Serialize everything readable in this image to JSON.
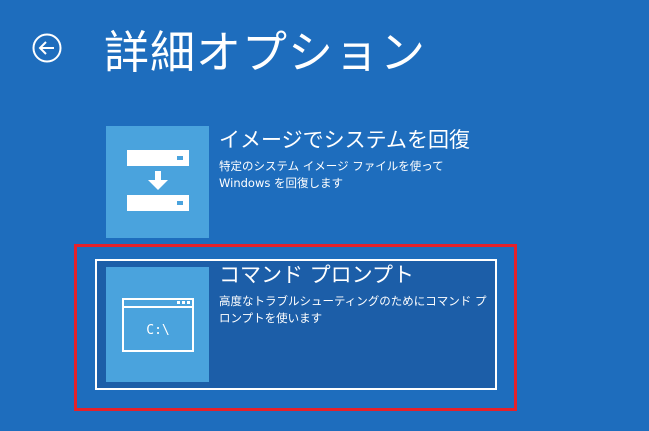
{
  "header": {
    "title": "詳細オプション",
    "back_icon": "back-arrow-icon"
  },
  "options": [
    {
      "title": "イメージでシステムを回復",
      "description": "特定のシステム イメージ ファイルを使って Windows を回復します",
      "icon": "system-image-recovery-icon"
    },
    {
      "title": "コマンド プロンプト",
      "description": "高度なトラブルシューティングのためにコマンド プロンプトを使います",
      "icon": "command-prompt-icon",
      "icon_text": "C:\\"
    }
  ],
  "colors": {
    "background": "#1e6dbd",
    "tile": "#4aa3dd",
    "selected_background": "#1c5ea8",
    "highlight_border": "#e5212a",
    "text": "#ffffff"
  }
}
